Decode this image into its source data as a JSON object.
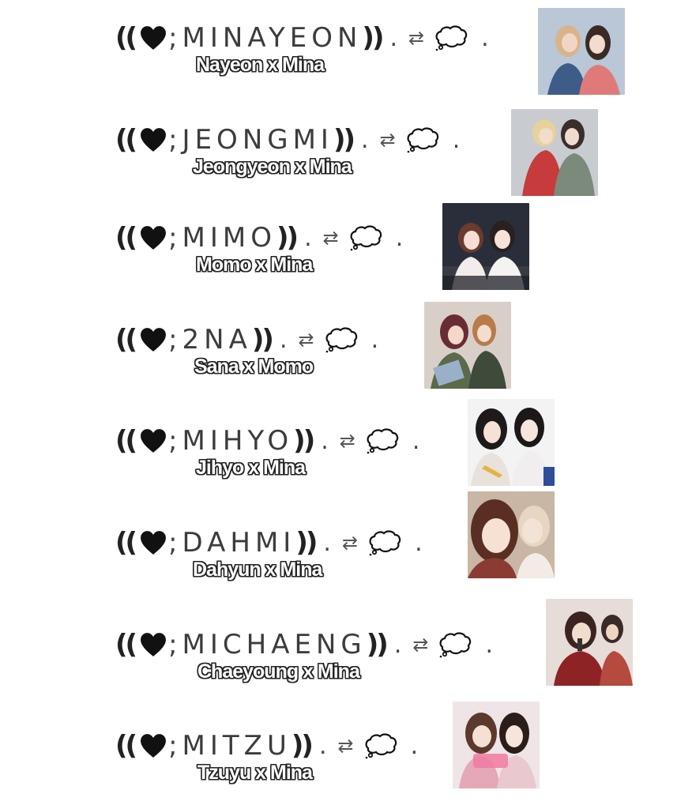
{
  "symbols": {
    "open": "((",
    "semicolon": ";",
    "close": "))",
    "dot": ".",
    "arrows": "⇄",
    "icon_heart": "heart-icon",
    "icon_bubble": "thought-bubble-icon"
  },
  "rows": [
    {
      "name": "MINAYEON",
      "caption": "Nayeon x Mina",
      "photo": {
        "bg": "#b9c7d6",
        "left": "#d9b38a",
        "right": "#3a2a26",
        "shirt_l": "#3e5c88",
        "shirt_r": "#e07a7a"
      }
    },
    {
      "name": "JEONGMI",
      "caption": "Jeongyeon x Mina",
      "photo": {
        "bg": "#c8ccd0",
        "left": "#e7d29a",
        "right": "#3b2d2a",
        "shirt_l": "#c63b3b",
        "shirt_r": "#7b8a7a"
      }
    },
    {
      "name": "MIMO",
      "caption": "Momo x Mina",
      "photo": {
        "bg": "#2a2e3a",
        "left": "#6b3b2e",
        "right": "#2b2020",
        "shirt_l": "#f2ecea",
        "shirt_r": "#f5f2f2"
      }
    },
    {
      "name": "2NA",
      "caption": "Sana x Momo",
      "photo": {
        "bg": "#d8d0c8",
        "left": "#6a2c34",
        "right": "#b77c4a",
        "shirt_l": "#5a6a4a",
        "shirt_r": "#3e4a3a"
      }
    },
    {
      "name": "MIHYO",
      "caption": "Jihyo x Mina",
      "photo": {
        "bg": "#f3f3f3",
        "left": "#1e1a1a",
        "right": "#1c1818",
        "shirt_l": "#e9e2dc",
        "shirt_r": "#f0eeee"
      }
    },
    {
      "name": "DAHMI",
      "caption": "Dahyun x Mina",
      "photo": {
        "bg": "#c9b6a4",
        "left": "#5a2e22",
        "right": "#e6d6c2",
        "shirt_l": "#8a3b34",
        "shirt_r": "#f3ece6"
      }
    },
    {
      "name": "MICHAENG",
      "caption": "Chaeyoung x Mina",
      "photo": {
        "bg": "#e6dcd8",
        "left": "#3b2420",
        "right": "#3a2a28",
        "shirt_l": "#8e2326",
        "shirt_r": "#b54a3f"
      }
    },
    {
      "name": "MITZU",
      "caption": "Tzuyu x Mina",
      "photo": {
        "bg": "#efe4e6",
        "left": "#5b3a2c",
        "right": "#2b1d1a",
        "shirt_l": "#e4a8b8",
        "shirt_r": "#e9c8cf"
      }
    }
  ]
}
